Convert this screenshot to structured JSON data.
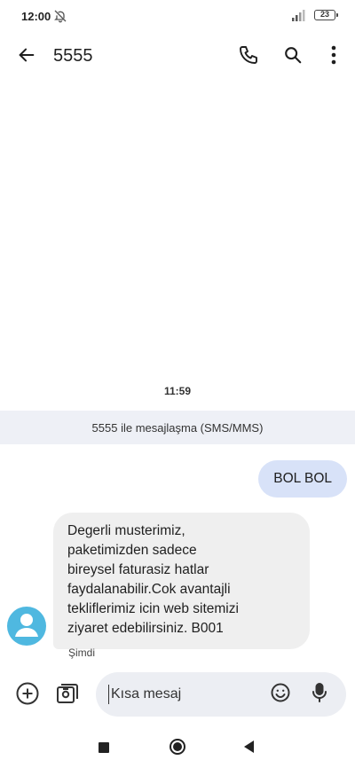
{
  "status_bar": {
    "time": "12:00",
    "battery": "23",
    "icons": [
      "bell-off-icon",
      "signal-icon",
      "battery-icon"
    ]
  },
  "app_bar": {
    "title": "5555",
    "icons": [
      "back-arrow-icon",
      "phone-icon",
      "search-icon",
      "more-vert-icon"
    ]
  },
  "conversation": {
    "timestamp": "11:59",
    "thread_banner": "5555 ile mesajlaşma (SMS/MMS)",
    "messages": [
      {
        "direction": "outgoing",
        "text": "BOL BOL"
      },
      {
        "direction": "incoming",
        "text": "Degerli musterimiz,\npaketimizden sadece\nbireysel faturasiz hatlar\nfaydalanabilir.Cok avantajli\ntekliflerimiz icin web sitemizi\nziyaret edebilirsiniz. B001",
        "time": "Şimdi"
      }
    ]
  },
  "compose": {
    "placeholder": "Kısa mesaj",
    "icons": [
      "add-circle-icon",
      "media-icon",
      "emoji-icon",
      "mic-icon"
    ]
  },
  "colors": {
    "outgoing_bubble": "#d8e2f8",
    "incoming_bubble": "#efefef",
    "avatar": "#4fb8e0",
    "banner": "#eef0f6",
    "compose_bg": "#eceef3"
  }
}
